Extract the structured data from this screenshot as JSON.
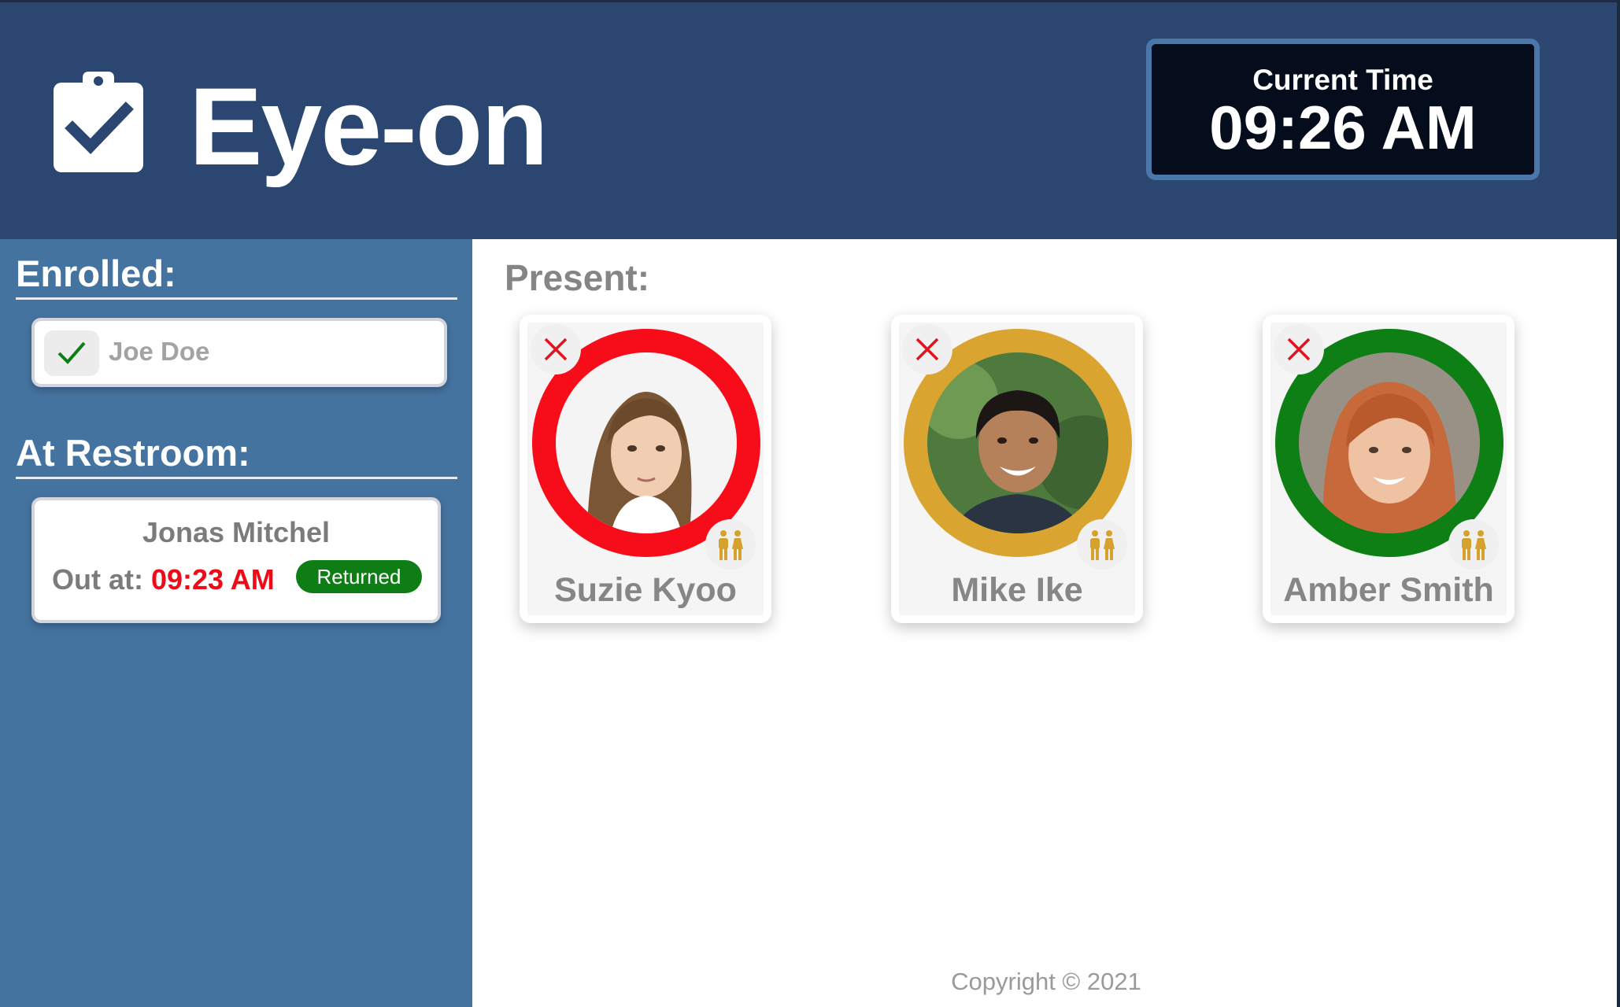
{
  "app": {
    "title": "Eye-on",
    "logo_icon": "clipboard-check-icon"
  },
  "clock": {
    "label": "Current Time",
    "value": "09:26 AM"
  },
  "sidebar": {
    "enrolled": {
      "title": "Enrolled:",
      "items": [
        {
          "name": "Joe Doe",
          "icon": "check-icon"
        }
      ]
    },
    "restroom": {
      "title": "At Restroom:",
      "items": [
        {
          "name": "Jonas Mitchel",
          "out_label": "Out at:",
          "out_time": "09:23 AM",
          "status": "Returned"
        }
      ]
    }
  },
  "main": {
    "title": "Present:",
    "students": [
      {
        "name": "Suzie Kyoo",
        "ring_color": "#f70d1a"
      },
      {
        "name": "Mike Ike",
        "ring_color": "#daa430"
      },
      {
        "name": "Amber Smith",
        "ring_color": "#0e7f14"
      }
    ]
  },
  "footer": {
    "copyright": "Copyright © 2021"
  },
  "colors": {
    "header_bg": "#2b4670",
    "sidebar_bg": "#4573a0",
    "alert_red": "#ee0a17",
    "returned_green": "#0f7d16",
    "restroom_icon": "#d6a22e"
  }
}
